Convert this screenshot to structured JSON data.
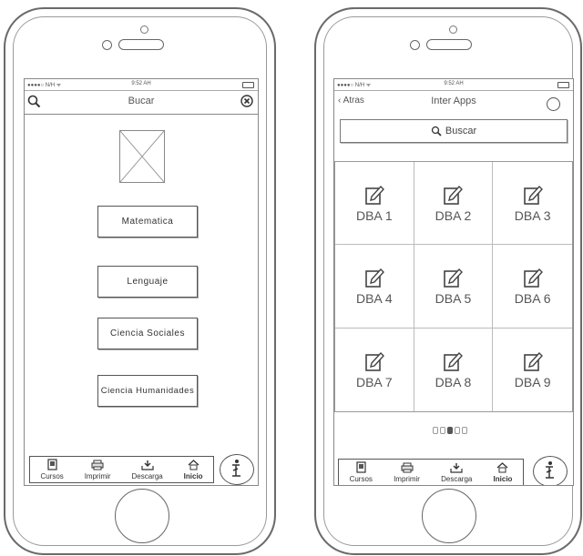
{
  "left_screen": {
    "status_bar": {
      "carrier": "●●●●○ N/H ᯤ",
      "time": "9:52 AH"
    },
    "nav": {
      "title": "Bucar"
    },
    "buttons": [
      "Matematica",
      "Lenguaje",
      "Ciencia Sociales",
      "Ciencia Humanidades"
    ],
    "tabbar": [
      {
        "label": "Cursos",
        "icon": "book-icon"
      },
      {
        "label": "Imprimir",
        "icon": "printer-icon"
      },
      {
        "label": "Descarga",
        "icon": "download-icon"
      },
      {
        "label": "Inicio",
        "icon": "home-icon",
        "active": true
      }
    ]
  },
  "right_screen": {
    "status_bar": {
      "carrier": "●●●●○ N/H ᯤ",
      "time": "9:52 AH"
    },
    "nav": {
      "back": "Atras",
      "title": "Inter Apps"
    },
    "search": {
      "label": "Buscar"
    },
    "grid": [
      "DBA 1",
      "DBA 2",
      "DBA 3",
      "DBA 4",
      "DBA 5",
      "DBA 6",
      "DBA 7",
      "DBA 8",
      "DBA 9"
    ],
    "page_dots": {
      "count": 5,
      "active": 2
    },
    "tabbar": [
      {
        "label": "Cursos",
        "icon": "book-icon"
      },
      {
        "label": "Imprimir",
        "icon": "printer-icon"
      },
      {
        "label": "Descarga",
        "icon": "download-icon"
      },
      {
        "label": "Inicio",
        "icon": "home-icon",
        "active": true
      }
    ]
  }
}
